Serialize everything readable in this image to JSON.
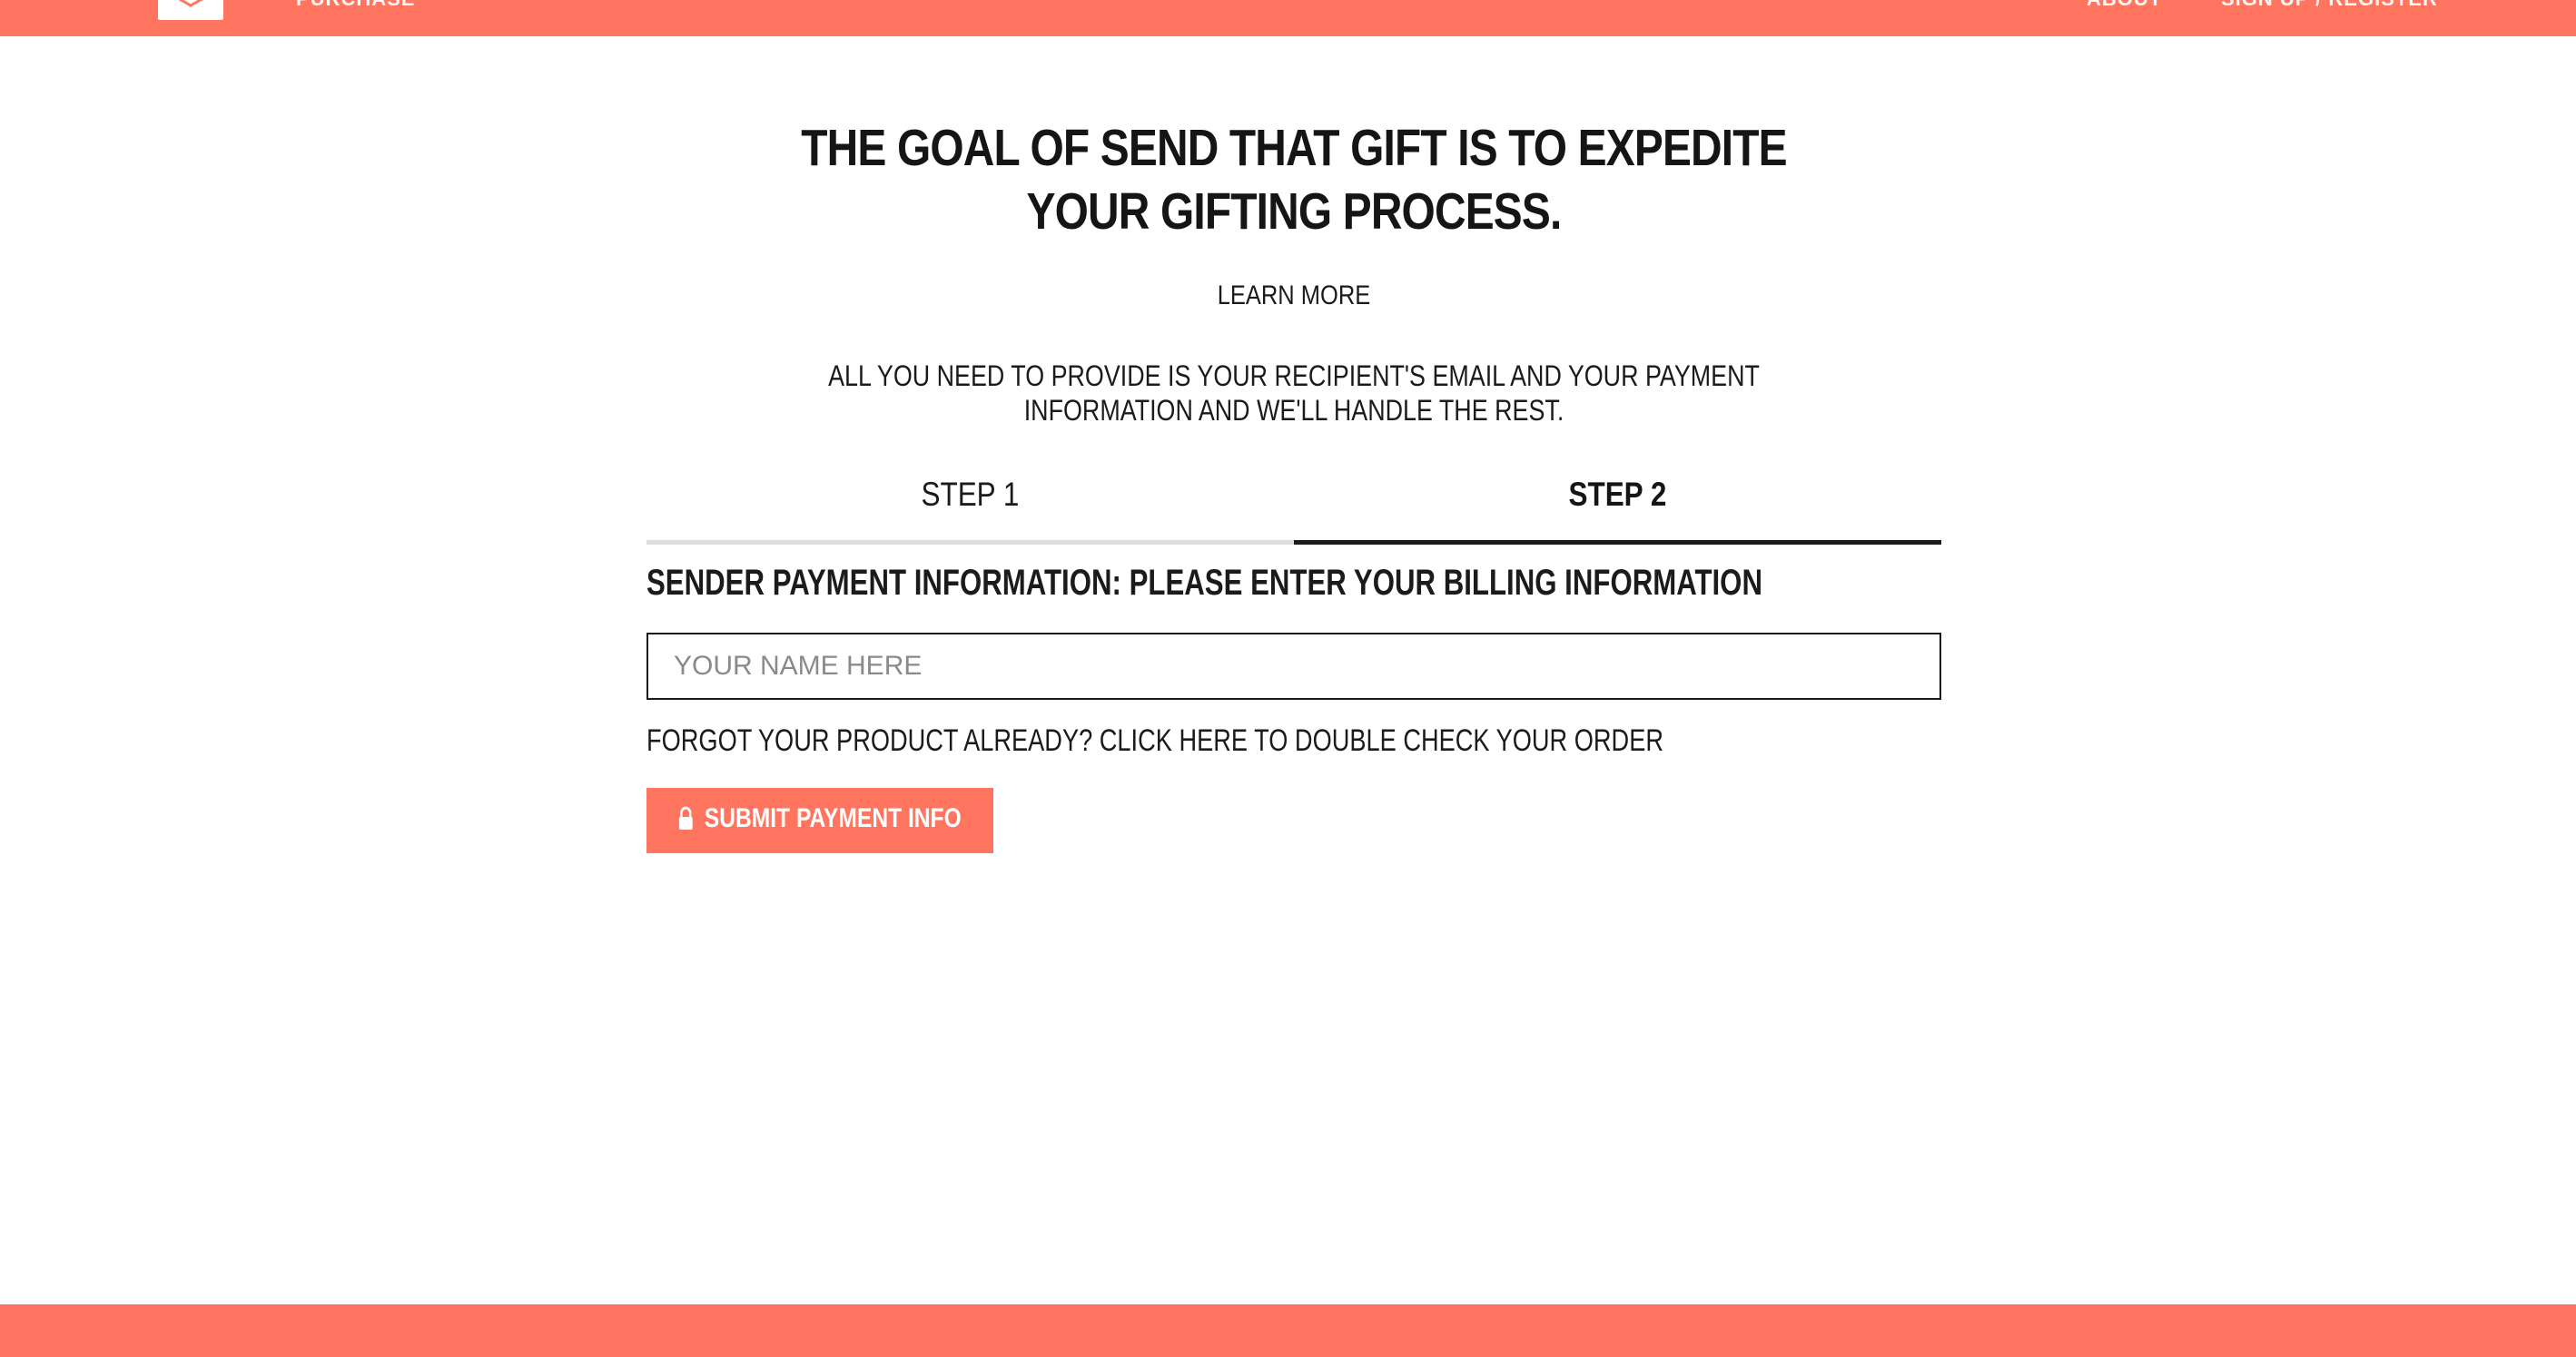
{
  "header": {
    "nav_left": "PURCHASE",
    "nav_right": [
      {
        "label": "ABOUT"
      },
      {
        "label": "SIGN UP / REGISTER"
      }
    ]
  },
  "hero": {
    "headline": "THE GOAL OF SEND THAT GIFT IS TO EXPEDITE YOUR GIFTING PROCESS.",
    "learn_more": "LEARN MORE",
    "intro": "ALL YOU NEED TO PROVIDE IS YOUR RECIPIENT'S EMAIL AND YOUR PAYMENT INFORMATION AND WE'LL HANDLE THE REST."
  },
  "steps": {
    "tabs": [
      {
        "label": "STEP 1",
        "active": false
      },
      {
        "label": "STEP 2",
        "active": true
      }
    ]
  },
  "form": {
    "heading": "SENDER PAYMENT INFORMATION: PLEASE ENTER YOUR BILLING INFORMATION",
    "name_input": {
      "value": "",
      "placeholder": "YOUR NAME HERE"
    },
    "forgot_link": "FORGOT YOUR PRODUCT ALREADY? CLICK HERE TO DOUBLE CHECK YOUR ORDER",
    "submit_label": "SUBMIT PAYMENT INFO",
    "submit_icon": "lock-icon"
  },
  "colors": {
    "accent": "#ff7560",
    "text": "#1b1b1b",
    "tab_inactive_underline": "#dedede",
    "tab_active_underline": "#1b1b1b"
  }
}
